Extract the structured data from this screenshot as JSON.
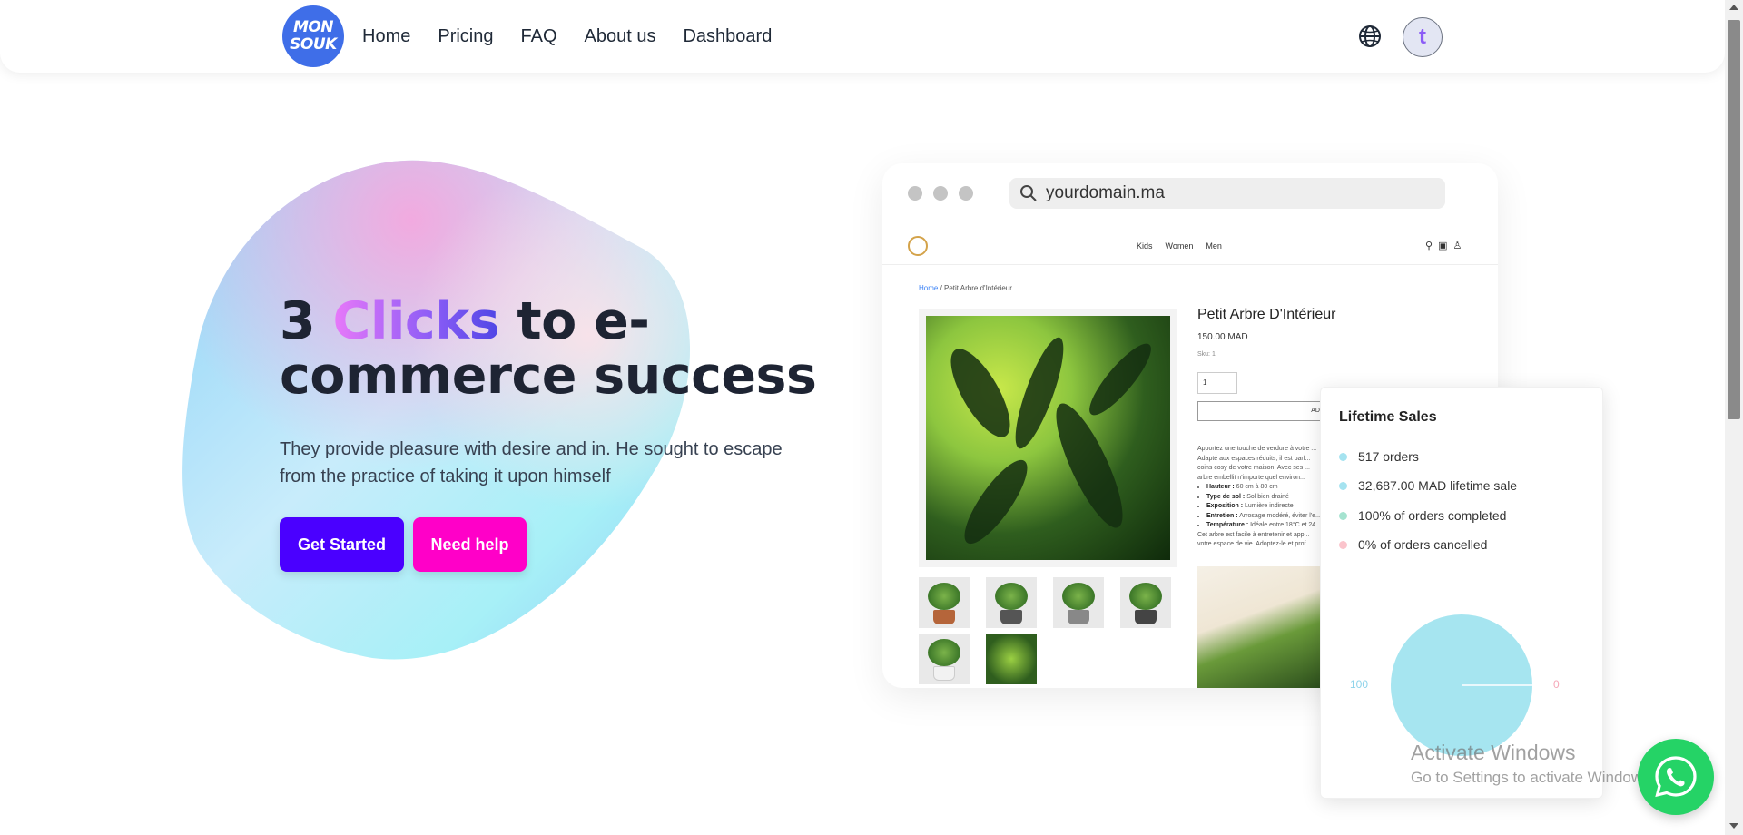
{
  "nav": {
    "logo_line1": "MON",
    "logo_line2": "SOUK",
    "links": [
      "Home",
      "Pricing",
      "FAQ",
      "About us",
      "Dashboard"
    ],
    "avatar_letter": "t"
  },
  "hero": {
    "title_part1": "3 ",
    "title_accent": "Clicks",
    "title_part2": " to e-commerce success",
    "subtitle": "They provide pleasure with desire and in. He sought to escape from the practice of taking it upon himself",
    "btn_primary": "Get Started",
    "btn_secondary": "Need help"
  },
  "browser": {
    "url": "yourdomain.ma",
    "shop_nav": [
      "Kids",
      "Women",
      "Men"
    ],
    "breadcrumb_home": "Home",
    "breadcrumb_sep": " / ",
    "breadcrumb_current": "Petit Arbre d'Intérieur",
    "product_name": "Petit Arbre D'Intérieur",
    "product_price": "150.00 MAD",
    "product_sku": "Sku: 1",
    "qty_value": "1",
    "add_button": "AD",
    "description": "Apportez une touche de verdure à votre ... Adapté aux espaces réduits, il est parf... coins cosy de votre maison. Avec ses ... arbre embellit n'importe quel environ...",
    "specs": [
      {
        "label": "Hauteur :",
        "value": " 60 cm à 80 cm"
      },
      {
        "label": "Type de sol :",
        "value": " Sol bien drainé"
      },
      {
        "label": "Exposition :",
        "value": " Lumière indirecte"
      },
      {
        "label": "Entretien :",
        "value": " Arrosage modéré, éviter l'e..."
      },
      {
        "label": "Température :",
        "value": " Idéale entre 18°C et 24..."
      }
    ],
    "description_end": "Cet arbre est facile à entretenir et app... votre espace de vie. Adoptez-le et prof..."
  },
  "sales": {
    "title": "Lifetime Sales",
    "stats": [
      {
        "text": "517 orders",
        "color": "#a5e3f0"
      },
      {
        "text": "32,687.00 MAD lifetime sale",
        "color": "#a5e3f0"
      },
      {
        "text": "100% of orders completed",
        "color": "#a5e3d0"
      },
      {
        "text": "0% of orders cancelled",
        "color": "#fbc4cc"
      }
    ],
    "pie_left_label": "100",
    "pie_right_label": "0",
    "pie_color": "#a6e5f0",
    "left_label_color": "#8ed3ea",
    "right_label_color": "#f6a7b8"
  },
  "watermark": {
    "line1": "Activate Windows",
    "line2": "Go to Settings to activate Windows."
  },
  "colors": {
    "primary": "#4a00ff",
    "secondary": "#ff00c8",
    "logo_bg": "#3f6ee8",
    "whatsapp": "#25d366"
  },
  "icons": {
    "globe": "globe-icon",
    "search": "search-icon",
    "whatsapp": "whatsapp-icon"
  }
}
